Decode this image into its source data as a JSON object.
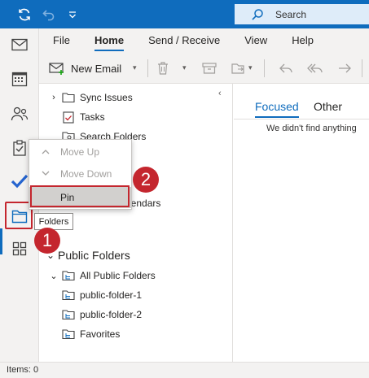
{
  "titlebar": {
    "search_label": "Search",
    "icons": [
      "sync-icon",
      "undo-icon",
      "customize-quick-access-icon",
      "search-icon"
    ]
  },
  "ribbon": {
    "tabs": [
      {
        "label": "File"
      },
      {
        "label": "Home"
      },
      {
        "label": "Send / Receive"
      },
      {
        "label": "View"
      },
      {
        "label": "Help"
      }
    ],
    "new_email_label": "New Email",
    "selected_tab": "Home"
  },
  "rail": {
    "items": [
      "mail-icon",
      "calendar-icon",
      "people-icon",
      "tasks-icon",
      "todo-icon",
      "folders-icon",
      "apps-icon"
    ],
    "active": "folders-icon"
  },
  "folders": {
    "items": [
      {
        "label": "Sync Issues"
      },
      {
        "label": "Tasks"
      },
      {
        "label": "Search Folders"
      },
      {
        "label": "lendars"
      }
    ],
    "public": {
      "header": "Public Folders",
      "all": "All Public Folders",
      "children": [
        {
          "label": "public-folder-1"
        },
        {
          "label": "public-folder-2"
        }
      ],
      "favorites": "Favorites"
    }
  },
  "context_menu": {
    "items": [
      {
        "label": "Move Up",
        "enabled": false
      },
      {
        "label": "Move Down",
        "enabled": false
      },
      {
        "label": "Pin",
        "enabled": true
      }
    ]
  },
  "tooltip": "Folders",
  "reading_pane": {
    "tab_focused": "Focused",
    "tab_other": "Other",
    "empty_message": "We didn't find anything"
  },
  "status": "Items: 0",
  "badges": [
    "1",
    "2"
  ],
  "colors": {
    "accent": "#0f6cbd",
    "annotation_red": "#c4262e"
  }
}
